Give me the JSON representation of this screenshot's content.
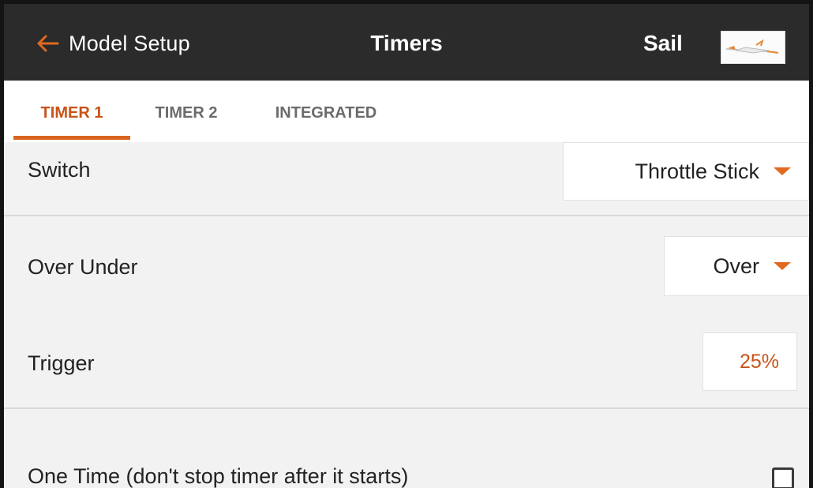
{
  "header": {
    "back_label": "Model Setup",
    "title": "Timers",
    "model_name": "Sail",
    "back_icon": "arrow-left-icon",
    "model_image": "glider-thumbnail"
  },
  "tabs": [
    {
      "label": "TIMER 1",
      "active": true
    },
    {
      "label": "TIMER 2",
      "active": false
    },
    {
      "label": "INTEGRATED",
      "active": false
    }
  ],
  "settings": {
    "switch": {
      "label": "Switch",
      "value": "Throttle Stick"
    },
    "over_under": {
      "label": "Over Under",
      "value": "Over"
    },
    "trigger": {
      "label": "Trigger",
      "value": "25%"
    },
    "one_time": {
      "label": "One Time (don't stop timer after it starts)",
      "checked": false
    }
  },
  "colors": {
    "accent": "#d9641f",
    "header_bg": "#2b2b2b",
    "content_bg": "#f2f2f2"
  }
}
